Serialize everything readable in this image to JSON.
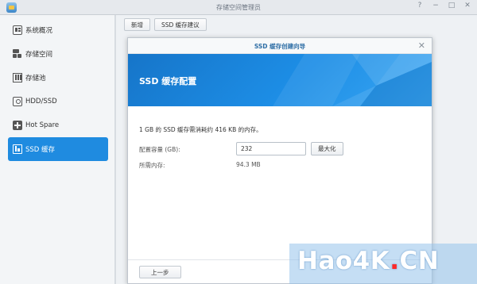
{
  "window": {
    "title": "存储空间管理员"
  },
  "window_controls": [
    "?",
    "−",
    "□",
    "✕"
  ],
  "sidebar": {
    "items": [
      {
        "label": "系统概况",
        "icon": "overview-icon",
        "active": false
      },
      {
        "label": "存储空间",
        "icon": "storage-space-icon",
        "active": false
      },
      {
        "label": "存储池",
        "icon": "storage-pool-icon",
        "active": false
      },
      {
        "label": "HDD/SSD",
        "icon": "hdd-icon",
        "active": false
      },
      {
        "label": "Hot Spare",
        "icon": "hot-spare-icon",
        "active": false
      },
      {
        "label": "SSD 缓存",
        "icon": "ssd-cache-icon",
        "active": true
      }
    ]
  },
  "toolbar": {
    "create_label": "新增",
    "advisor_label": "SSD 缓存建议"
  },
  "dialog": {
    "title": "SSD 缓存创建向导",
    "close": "✕",
    "banner_title": "SSD 缓存配置",
    "info": "1 GB 的 SSD 缓存需消耗约 416 KB 的内存。",
    "capacity_label": "配置容量 (GB):",
    "capacity_value": "232",
    "max_label": "最大化",
    "memory_label": "所需内存:",
    "memory_value": "94.3 MB",
    "prev_label": "上一步"
  },
  "watermark": {
    "text": "Hao4K",
    "dot": ".",
    "suffix": "CN"
  },
  "colors": {
    "accent": "#1f8be0",
    "banner": "#1d8ee6",
    "watermark_dot": "#ff2a2a"
  }
}
